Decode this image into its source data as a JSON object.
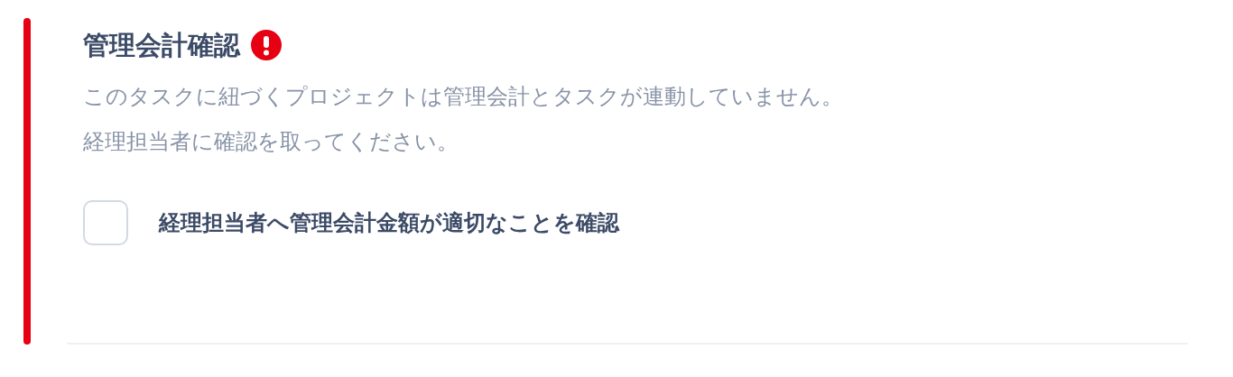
{
  "section": {
    "title": "管理会計確認",
    "alert": true,
    "description": [
      "このタスクに紐づくプロジェクトは管理会計とタスクが連動していません。",
      "経理担当者に確認を取ってください。"
    ],
    "checklist": [
      {
        "label": "経理担当者へ管理会計金額が適切なことを確認",
        "checked": false
      }
    ]
  }
}
